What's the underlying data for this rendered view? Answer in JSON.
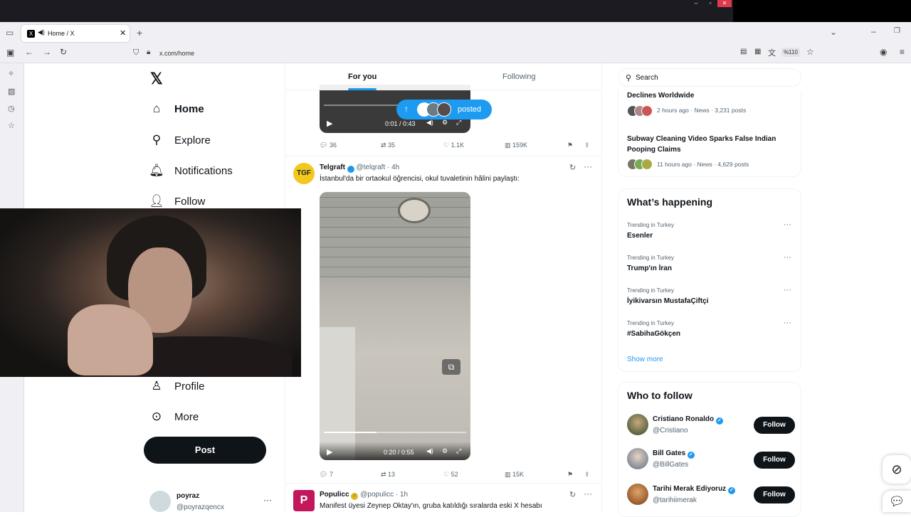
{
  "browser": {
    "tab_title": "Home / X",
    "url": "x.com/home",
    "zoom": "%110"
  },
  "nav": {
    "home": "Home",
    "explore": "Explore",
    "notifications": "Notifications",
    "follow": "Follow",
    "profile": "Profile",
    "more": "More",
    "post_button": "Post"
  },
  "account": {
    "name": "poyraz",
    "handle": "@poyrazqencx"
  },
  "timeline": {
    "tabs": [
      "For you",
      "Following"
    ],
    "new_posts_pill": "posted",
    "post1": {
      "video_time": "0:01 / 0:43",
      "replies": "36",
      "reposts": "35",
      "likes": "1.1K",
      "views": "159K"
    },
    "post2": {
      "author": "Telgraft",
      "handle": "@telqraft",
      "time": "· 4h",
      "text": "İstanbul'da bir ortaokul öğrencisi, okul tuvaletinin hâlini paylaştı:",
      "video_time": "0:20 / 0:55",
      "replies": "7",
      "reposts": "13",
      "likes": "52",
      "views": "15K"
    },
    "post3": {
      "author": "Populicc",
      "handle": "@populicc",
      "time": "· 1h",
      "text": "Manifest üyesi Zeynep Oktay'ın, gruba katıldığı sıralarda eski X hesabı"
    }
  },
  "right": {
    "search_placeholder": "Search",
    "news": [
      {
        "title": "Declines Worldwide",
        "meta": "2 hours ago · News · 3,231 posts"
      },
      {
        "title": "Subway Cleaning Video Sparks False Indian Pooping Claims",
        "meta": "11 hours ago · News · 4,629 posts"
      }
    ],
    "whats_happening": "What’s happening",
    "trends": [
      {
        "category": "Trending in Turkey",
        "name": "Esenler"
      },
      {
        "category": "Trending in Turkey",
        "name": "Trump'ın İran"
      },
      {
        "category": "Trending in Turkey",
        "name": "İyikivarsın MustafaÇiftçi"
      },
      {
        "category": "Trending in Turkey",
        "name": "#SabihaGökçen"
      }
    ],
    "show_more": "Show more",
    "who_to_follow": "Who to follow",
    "suggestions": [
      {
        "name": "Cristiano Ronaldo",
        "handle": "@Cristiano"
      },
      {
        "name": "Bill Gates",
        "handle": "@BillGates"
      },
      {
        "name": "Tarihi Merak Ediyoruz",
        "handle": "@tarihiimerak"
      }
    ],
    "follow_label": "Follow"
  }
}
